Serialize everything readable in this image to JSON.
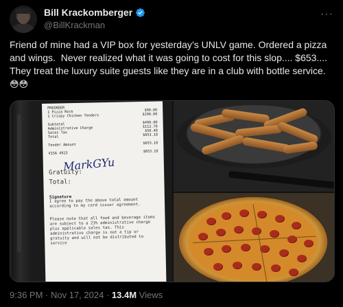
{
  "author": {
    "display_name": "Bill Krackomberger",
    "handle": "@BillKrackman",
    "verified_icon": "verified-badge-icon",
    "more_label": "···"
  },
  "tweet": {
    "text": "Friend of mine had a VIP box for yesterday’s UNLV game. Ordered a pizza and wings.  Never realized what it was going to cost for this slop.... $653.... They treat the luxury suite guests like they are in a club with bottle service.",
    "emojis": "😳😳"
  },
  "receipt": {
    "header": "PREORDER",
    "items": [
      {
        "label": "1 Pizza Rock",
        "value": "$90.00"
      },
      {
        "label": "1 Crispy Chicken Tenders",
        "value": "$190.00"
      }
    ],
    "totals": [
      {
        "label": "Subtotal",
        "value": "$490.00"
      },
      {
        "label": "Administrative Charge",
        "value": "$112.70"
      },
      {
        "label": "Sales Tax",
        "value": "$50.48"
      },
      {
        "label": "Total",
        "value": "$653.18"
      }
    ],
    "tender": {
      "label": "Tender Amount",
      "value": "$653.18"
    },
    "card": {
      "label": "VISA 4923",
      "value": "$653.18"
    },
    "signature": "MarkGYu",
    "gratuity_label": "Gratuity:",
    "total_label": "Total:",
    "signature_heading": "Signature",
    "agreement": "I agree to pay the above total amount according to my card issuer agreement.",
    "note": "Please note that all food and beverage items are subject to a 23% administrative charge plus applicable sales tax. This administrative charge is not a tip or gratuity and will not be distributed to service"
  },
  "meta": {
    "time": "9:36 PM",
    "sep1": " · ",
    "date": "Nov 17, 2024",
    "sep2": " · ",
    "views_count": "13.4M",
    "views_label": " Views"
  }
}
